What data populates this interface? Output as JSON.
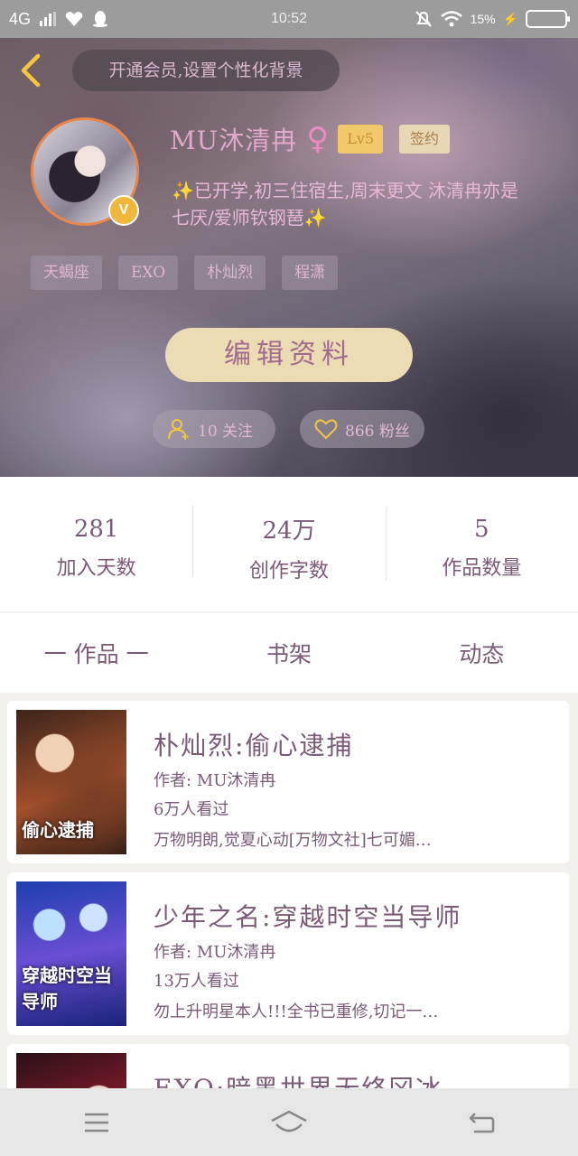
{
  "status_bar": {
    "network": "4G",
    "time": "10:52",
    "battery_text": "15%"
  },
  "header": {
    "vip_banner": "开通会员,设置个性化背景",
    "username": "MU沐清冉",
    "level": "Lv5",
    "signed": "签约",
    "bio": "已开学,初三住宿生,周末更文 沐清冉亦是七厌/爱师钦钢琶",
    "tags": [
      "天蝎座",
      "EXO",
      "朴灿烈",
      "程潇"
    ],
    "edit_button": "编辑资料",
    "follow": "10 关注",
    "fans": "866 粉丝"
  },
  "stats": [
    {
      "value": "281",
      "label": "加入天数"
    },
    {
      "value": "24万",
      "label": "创作字数"
    },
    {
      "value": "5",
      "label": "作品数量"
    }
  ],
  "tabs": [
    "一 作品 一",
    "书架",
    "动态"
  ],
  "works": [
    {
      "title": "朴灿烈:偷心逮捕",
      "author": "作者: MU沐清冉",
      "views": "6万人看过",
      "desc": "万物明朗,觉夏心动[万物文社]七可媚…",
      "cover_text": "偷心逮捕"
    },
    {
      "title": "少年之名:穿越时空当导师",
      "author": "作者: MU沐清冉",
      "views": "13万人看过",
      "desc": "勿上升明星本人!!!全书已重修,切记一…",
      "cover_text": "穿越时空当导师"
    },
    {
      "title": "EXO:暗黑世界无终冈冰",
      "author": "",
      "views": "",
      "desc": "",
      "cover_text": ""
    }
  ],
  "colors": {
    "accent_text": "#7b5a78",
    "edit_button_bg": "#ecdcb4",
    "level_badge": "#f2c96a",
    "avatar_ring": "#e9864c"
  }
}
